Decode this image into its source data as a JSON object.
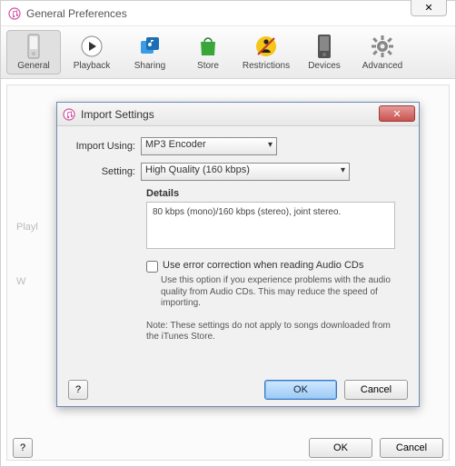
{
  "parentWindow": {
    "title": "General Preferences",
    "closeGlyph": "✕",
    "toolbar": [
      {
        "label": "General"
      },
      {
        "label": "Playback"
      },
      {
        "label": "Sharing"
      },
      {
        "label": "Store"
      },
      {
        "label": "Restrictions"
      },
      {
        "label": "Devices"
      },
      {
        "label": "Advanced"
      }
    ],
    "fadedLabels": {
      "playlists": "Playl",
      "w": "W"
    },
    "buttons": {
      "ok": "OK",
      "cancel": "Cancel",
      "help": "?"
    }
  },
  "modal": {
    "title": "Import Settings",
    "labels": {
      "importUsing": "Import Using:",
      "setting": "Setting:",
      "details": "Details"
    },
    "importUsingValue": "MP3 Encoder",
    "settingValue": "High Quality (160 kbps)",
    "detailsText": "80 kbps (mono)/160 kbps (stereo), joint stereo.",
    "errorCorrection": {
      "checked": false,
      "label": "Use error correction when reading Audio CDs",
      "hint": "Use this option if you experience problems with the audio quality from Audio CDs.  This may reduce the speed of importing."
    },
    "note": "Note: These settings do not apply to songs downloaded from the iTunes Store.",
    "buttons": {
      "ok": "OK",
      "cancel": "Cancel",
      "help": "?"
    }
  }
}
